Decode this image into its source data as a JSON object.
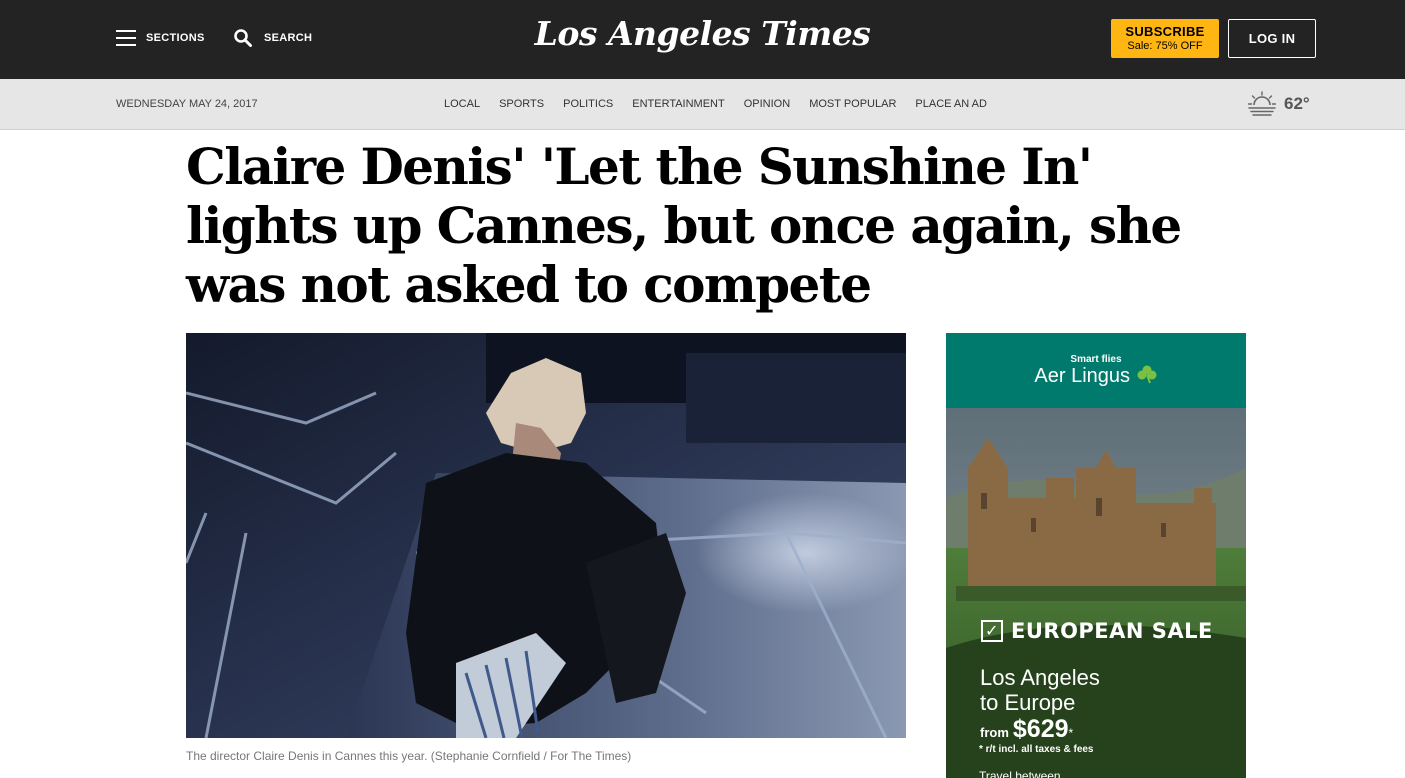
{
  "header": {
    "sections_label": "SECTIONS",
    "search_label": "SEARCH",
    "logo_text": "Los Angeles Times",
    "subscribe_label": "SUBSCRIBE",
    "subscribe_offer": "Sale: 75% OFF",
    "login_label": "LOG IN",
    "colors": {
      "bar": "#232323",
      "subscribe": "#ffb612"
    }
  },
  "subnav": {
    "date": "WEDNESDAY MAY 24, 2017",
    "items": [
      "LOCAL",
      "SPORTS",
      "POLITICS",
      "ENTERTAINMENT",
      "OPINION",
      "MOST POPULAR",
      "PLACE AN AD"
    ],
    "weather_icon": "sunrise-icon",
    "temperature": "62°"
  },
  "article": {
    "headline": "Claire Denis' 'Let the Sunshine In' lights up Cannes, but once again, she was not asked to compete",
    "photo_caption": "The director Claire Denis in Cannes this year. (Stephanie Cornfield / For The Times)"
  },
  "ad": {
    "tagline": "Smart flies",
    "brand": "Aer Lingus",
    "brand_icon": "shamrock-icon",
    "sale_title": "EUROPEAN SALE",
    "route_line1": "Los Angeles",
    "route_line2": "to Europe",
    "from_label": "from",
    "price": "$629",
    "price_mark": "*",
    "fine_print": "* r/t incl. all taxes & fees",
    "more_text": "Travel between",
    "colors": {
      "brand_band": "#007a6c",
      "shamrock": "#7ac143"
    }
  }
}
